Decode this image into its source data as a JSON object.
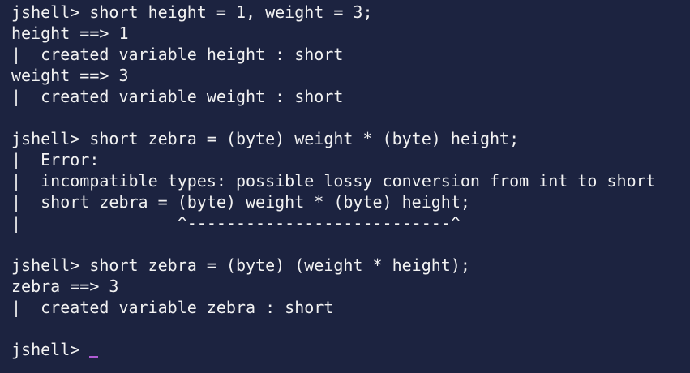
{
  "terminal": {
    "lines": [
      "jshell> short height = 1, weight = 3;",
      "height ==> 1",
      "|  created variable height : short",
      "weight ==> 3",
      "|  created variable weight : short",
      "",
      "jshell> short zebra = (byte) weight * (byte) height;",
      "|  Error:",
      "|  incompatible types: possible lossy conversion from int to short",
      "|  short zebra = (byte) weight * (byte) height;",
      "|                ^---------------------------^",
      "",
      "jshell> short zebra = (byte) (weight * height);",
      "zebra ==> 3",
      "|  created variable zebra : short",
      "",
      "jshell>"
    ]
  },
  "colors": {
    "background": "#1c2340",
    "text": "#f2f2f2",
    "cursor": "#b05bd4"
  }
}
